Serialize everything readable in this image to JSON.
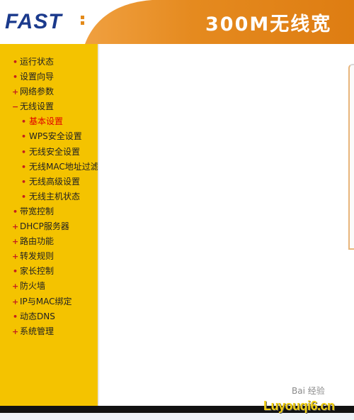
{
  "header": {
    "logo_text": "FAST",
    "product_title": "300M无线宽",
    "brand_orange": "#e38a1a",
    "brand_blue": "#1b3a8c"
  },
  "sidebar": {
    "background": "#f4c300",
    "items": [
      {
        "label": "运行状态",
        "marker": "•",
        "level": 0
      },
      {
        "label": "设置向导",
        "marker": "•",
        "level": 0
      },
      {
        "label": "网络参数",
        "marker": "+",
        "level": 0
      },
      {
        "label": "无线设置",
        "marker": "−",
        "level": 0,
        "expanded": true
      },
      {
        "label": "基本设置",
        "marker": "•",
        "level": 1,
        "active": true
      },
      {
        "label": "WPS安全设置",
        "marker": "•",
        "level": 1
      },
      {
        "label": "无线安全设置",
        "marker": "•",
        "level": 1
      },
      {
        "label": "无线MAC地址过滤",
        "marker": "•",
        "level": 1
      },
      {
        "label": "无线高级设置",
        "marker": "•",
        "level": 1
      },
      {
        "label": "无线主机状态",
        "marker": "•",
        "level": 1
      },
      {
        "label": "带宽控制",
        "marker": "•",
        "level": 0
      },
      {
        "label": "DHCP服务器",
        "marker": "+",
        "level": 0
      },
      {
        "label": "路由功能",
        "marker": "+",
        "level": 0
      },
      {
        "label": "转发规则",
        "marker": "+",
        "level": 0
      },
      {
        "label": "家长控制",
        "marker": "•",
        "level": 0
      },
      {
        "label": "防火墙",
        "marker": "+",
        "level": 0
      },
      {
        "label": "IP与MAC绑定",
        "marker": "+",
        "level": 0
      },
      {
        "label": "动态DNS",
        "marker": "•",
        "level": 0
      },
      {
        "label": "系统管理",
        "marker": "+",
        "level": 0
      }
    ]
  },
  "watermark": {
    "top_text": "Bai 经验",
    "site_text": "Luyouqi6.cn"
  }
}
